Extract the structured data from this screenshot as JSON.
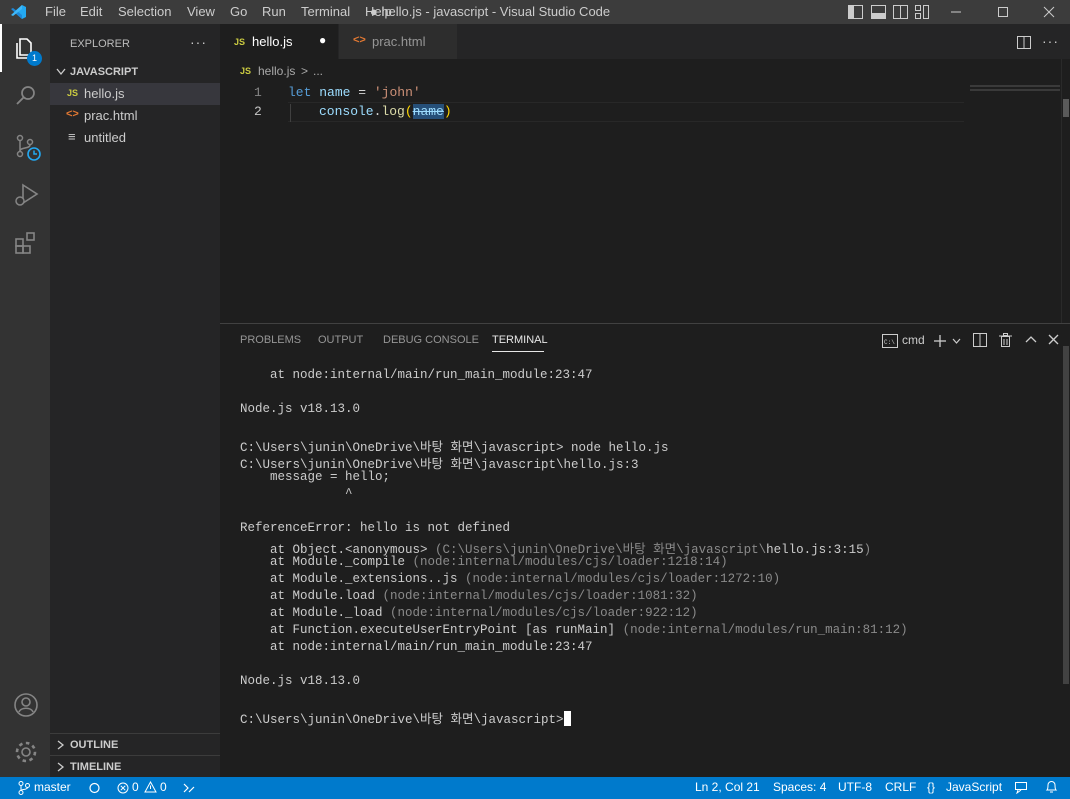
{
  "titlebar": {
    "menus": [
      "File",
      "Edit",
      "Selection",
      "View",
      "Go",
      "Run",
      "Terminal",
      "Help"
    ],
    "title": "● hello.js - javascript - Visual Studio Code"
  },
  "activity": {
    "items": [
      "explorer-icon",
      "search-icon",
      "source-control-icon",
      "run-debug-icon",
      "extensions-icon"
    ],
    "badge": "1",
    "bottom": [
      "account-icon",
      "settings-gear-icon"
    ]
  },
  "sidebar": {
    "header": "EXPLORER",
    "more": "···",
    "folder": "JAVASCRIPT",
    "files": [
      {
        "name": "hello.js",
        "icon": "JS",
        "selected": true
      },
      {
        "name": "prac.html",
        "icon": "<>",
        "selected": false
      },
      {
        "name": "untitled",
        "icon": "≡",
        "selected": false
      }
    ],
    "outline": "OUTLINE",
    "timeline": "TIMELINE"
  },
  "tabs": [
    {
      "icon": "JS",
      "label": "hello.js",
      "active": true,
      "dirty": "●"
    },
    {
      "icon": "<>",
      "label": "prac.html",
      "active": false,
      "dirty": ""
    }
  ],
  "breadcrumb": {
    "icon": "JS",
    "file": "hello.js",
    "sep": ">",
    "rest": "..."
  },
  "editor": {
    "lines": [
      {
        "num": "1",
        "kw": "let",
        "name": "name",
        "op": "=",
        "str": "'john'"
      },
      {
        "num": "2",
        "obj": "console",
        "dot": ".",
        "fn": "log",
        "open": "(",
        "arg": "name",
        "close": ")"
      }
    ]
  },
  "panel": {
    "tabs": [
      "PROBLEMS",
      "OUTPUT",
      "DEBUG CONSOLE",
      "TERMINAL"
    ],
    "active_tab": "TERMINAL",
    "shell": "cmd",
    "terminal": [
      {
        "text": "    at node:internal/main/run_main_module:23:47",
        "dim": ""
      },
      {
        "text": "",
        "dim": ""
      },
      {
        "text": "Node.js v18.13.0",
        "dim": ""
      },
      {
        "text": "",
        "dim": ""
      },
      {
        "text": "C:\\Users\\junin\\OneDrive\\바탕 화면\\javascript> node hello.js",
        "dim": ""
      },
      {
        "text": "C:\\Users\\junin\\OneDrive\\바탕 화면\\javascript\\hello.js:3",
        "dim": ""
      },
      {
        "text": "    message = hello;",
        "dim": ""
      },
      {
        "text": "              ^",
        "dim": ""
      },
      {
        "text": "",
        "dim": ""
      },
      {
        "text": "ReferenceError: hello is not defined",
        "dim": ""
      },
      {
        "text": "    at Object.<anonymous> ",
        "dim": "(C:\\Users\\junin\\OneDrive\\바탕 화면\\javascript\\",
        "tail": "hello.js:3:15",
        "end": ")"
      },
      {
        "text": "    at Module._compile ",
        "dim": "(node:internal/modules/cjs/loader:1218:14)"
      },
      {
        "text": "    at Module._extensions..js ",
        "dim": "(node:internal/modules/cjs/loader:1272:10)"
      },
      {
        "text": "    at Module.load ",
        "dim": "(node:internal/modules/cjs/loader:1081:32)"
      },
      {
        "text": "    at Module._load ",
        "dim": "(node:internal/modules/cjs/loader:922:12)"
      },
      {
        "text": "    at Function.executeUserEntryPoint [as runMain] ",
        "dim": "(node:internal/modules/run_main:81:12)"
      },
      {
        "text": "    at node:internal/main/run_main_module:23:47",
        "dim": ""
      },
      {
        "text": "",
        "dim": ""
      },
      {
        "text": "Node.js v18.13.0",
        "dim": ""
      },
      {
        "text": "",
        "dim": ""
      },
      {
        "text": "C:\\Users\\junin\\OneDrive\\바탕 화면\\javascript>",
        "dim": ""
      }
    ]
  },
  "status": {
    "branch": "master",
    "errors": "0",
    "warnings": "0",
    "position": "Ln 2, Col 21",
    "spaces": "Spaces: 4",
    "encoding": "UTF-8",
    "eol": "CRLF",
    "language": "JavaScript"
  },
  "colors": {
    "accent": "#007acc",
    "keyword": "#569cd6",
    "variable": "#9cdcfe",
    "string": "#ce9178",
    "function": "#dcdcaa",
    "js_icon": "#cbcb41",
    "html_icon": "#e37933"
  }
}
